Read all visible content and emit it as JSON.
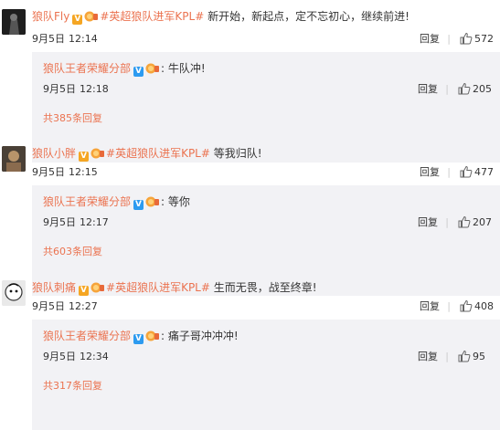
{
  "reply_label": "回复",
  "comments": [
    {
      "user": "狼队Fly",
      "topic": "#英超狼队进军KPL#",
      "text": "新开始，新起点，定不忘初心，继续前进!",
      "date": "9月5日",
      "time": "12:14",
      "likes": "572",
      "sub": {
        "user": "狼队王者荣耀分部",
        "text": "牛队冲!",
        "date": "9月5日",
        "time": "12:18",
        "likes": "205",
        "more": "共385条回复"
      }
    },
    {
      "user": "狼队小胖",
      "topic": "#英超狼队进军KPL#",
      "text": "等我归队!",
      "date": "9月5日",
      "time": "12:15",
      "likes": "477",
      "sub": {
        "user": "狼队王者荣耀分部",
        "text": "等你",
        "date": "9月5日",
        "time": "12:17",
        "likes": "207",
        "more": "共603条回复"
      }
    },
    {
      "user": "狼队刺痛",
      "topic": "#英超狼队进军KPL#",
      "text": "生而无畏，战至终章!",
      "date": "9月5日",
      "time": "12:27",
      "likes": "408",
      "sub": {
        "user": "狼队王者荣耀分部",
        "text": "痛子哥冲冲冲!",
        "date": "9月5日",
        "time": "12:34",
        "likes": "95",
        "more": "共317条回复"
      }
    }
  ],
  "colors": {
    "link": "#eb7350",
    "sub_bg": "#f2f2f5",
    "gold_v": "#f5a623",
    "blue_v": "#2d9bf0"
  }
}
